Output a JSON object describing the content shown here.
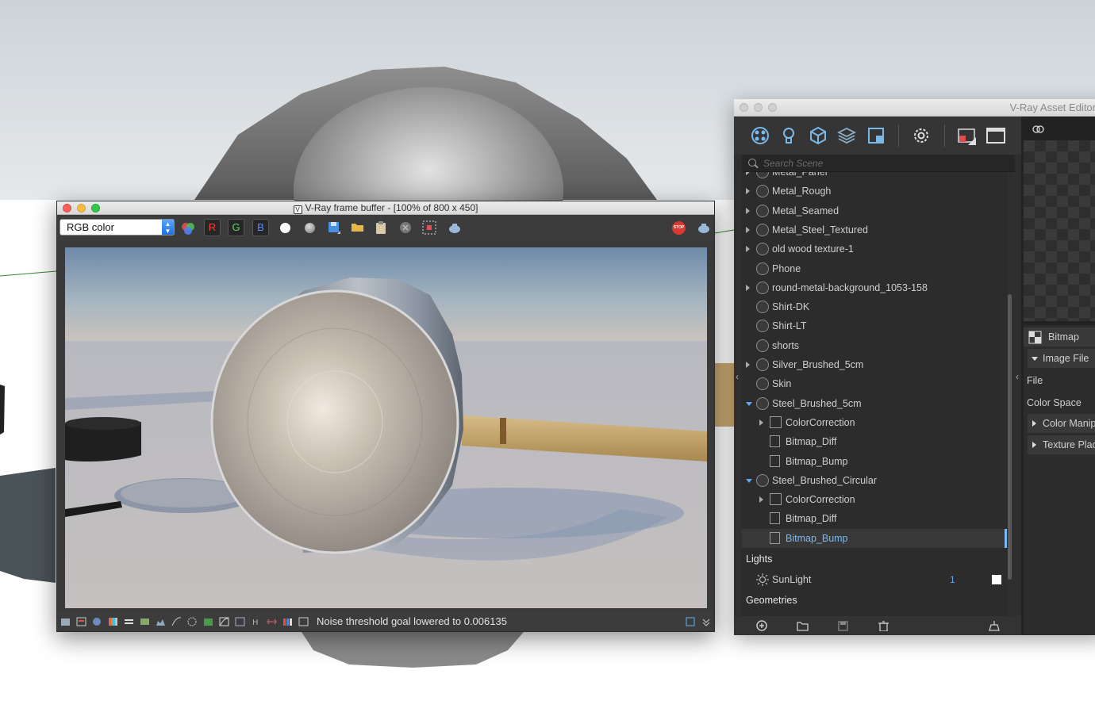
{
  "frame_buffer": {
    "title": "V-Ray frame buffer - [100% of 800 x 450]",
    "channel": "RGB color",
    "rgb_buttons": [
      "R",
      "G",
      "B"
    ],
    "stop_label": "STOP",
    "status": "Noise threshold goal lowered to 0.006135"
  },
  "asset_editor": {
    "title": "V-Ray Asset Editor",
    "search_placeholder": "Search Scene",
    "items": [
      {
        "label": "Metal_Panel",
        "type": "material",
        "expand": "right"
      },
      {
        "label": "Metal_Rough",
        "type": "material",
        "expand": "right"
      },
      {
        "label": "Metal_Seamed",
        "type": "material",
        "expand": "right"
      },
      {
        "label": "Metal_Steel_Textured",
        "type": "material",
        "expand": "right"
      },
      {
        "label": "old wood texture-1",
        "type": "material",
        "expand": "right"
      },
      {
        "label": "Phone",
        "type": "material",
        "expand": "none"
      },
      {
        "label": "round-metal-background_1053-158",
        "type": "material",
        "expand": "right"
      },
      {
        "label": "Shirt-DK",
        "type": "material",
        "expand": "none"
      },
      {
        "label": "Shirt-LT",
        "type": "material",
        "expand": "none"
      },
      {
        "label": "shorts",
        "type": "material",
        "expand": "none"
      },
      {
        "label": "Silver_Brushed_5cm",
        "type": "material",
        "expand": "right"
      },
      {
        "label": "Skin",
        "type": "material",
        "expand": "none"
      },
      {
        "label": "Steel_Brushed_5cm",
        "type": "material",
        "expand": "down"
      },
      {
        "label": "ColorCorrection",
        "type": "cc",
        "expand": "right"
      },
      {
        "label": "Bitmap_Diff",
        "type": "texture",
        "expand": "none"
      },
      {
        "label": "Bitmap_Bump",
        "type": "texture",
        "expand": "none"
      },
      {
        "label": "Steel_Brushed_Circular",
        "type": "material",
        "expand": "down"
      },
      {
        "label": "ColorCorrection",
        "type": "cc",
        "expand": "right"
      },
      {
        "label": "Bitmap_Diff",
        "type": "texture",
        "expand": "none"
      },
      {
        "label": "Bitmap_Bump",
        "type": "texture",
        "expand": "none",
        "selected": true
      }
    ],
    "lights_label": "Lights",
    "light": {
      "label": "SunLight",
      "count": "1"
    },
    "geometries_label": "Geometries",
    "props": {
      "header": "Bitmap",
      "image_file": "Image File",
      "file": "File",
      "color_space": "Color Space",
      "color_manip": "Color Manip",
      "texture_place": "Texture Plac"
    }
  },
  "colors": {
    "accent": "#5ea8f2",
    "selected_text": "#7cb8f2",
    "panel_bg": "#2f2f2f",
    "stop_red": "#d63a32"
  }
}
